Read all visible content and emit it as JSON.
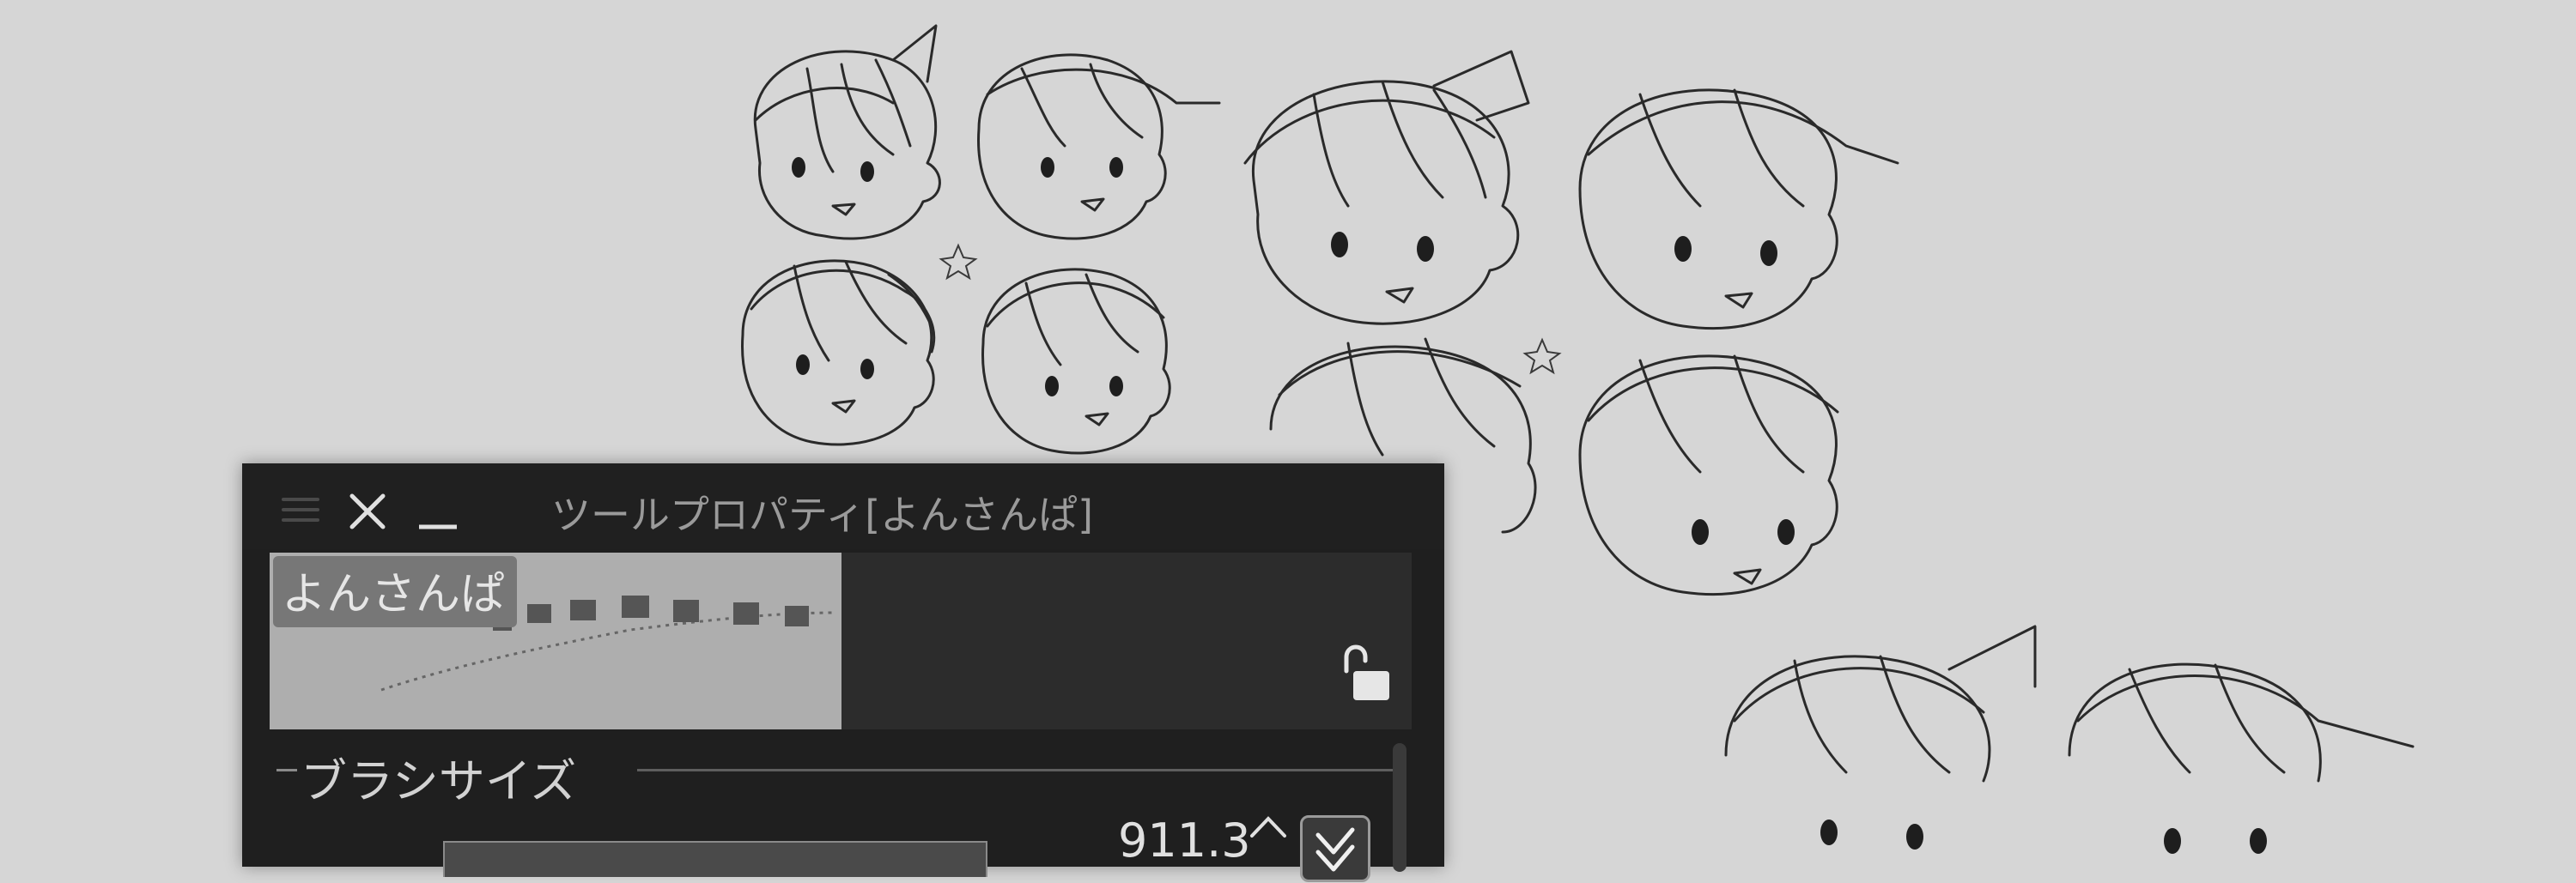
{
  "panel": {
    "title": "ツールプロパティ[よんさんぱ]",
    "brush_name": "よんさんぱ",
    "section_label": "ブラシサイズ",
    "brush_size_value": "911.3"
  },
  "icons": {
    "menu": "hamburger-menu-icon",
    "close": "close-icon",
    "minimize": "minimize-icon",
    "lock": "unlocked-padlock-icon",
    "increment": "chevron-up-icon",
    "checkbox": "checkmark-icon"
  },
  "colors": {
    "canvas": "#d6d6d6",
    "panel": "#1f1f1f",
    "preview_light": "#aeaeae",
    "text": "#d2d2d2"
  }
}
